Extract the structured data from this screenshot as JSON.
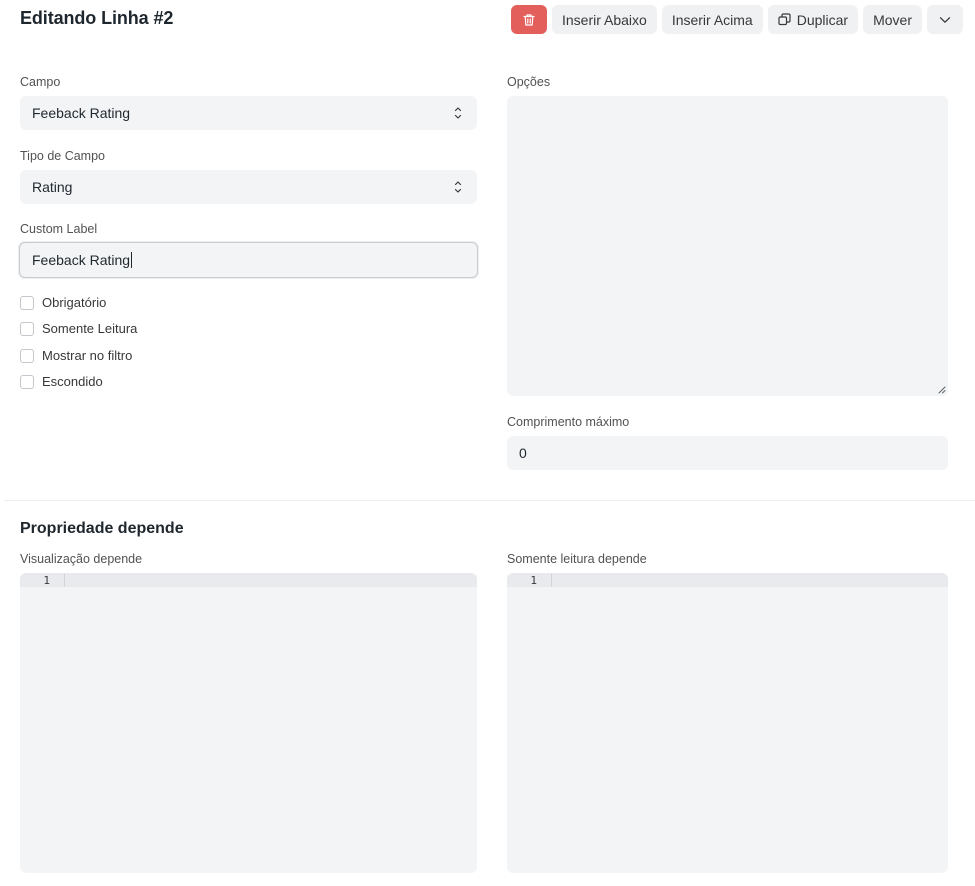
{
  "header": {
    "title": "Editando Linha #2",
    "buttons": {
      "delete_icon": "trash-icon",
      "insert_below": "Inserir Abaixo",
      "insert_above": "Inserir Acima",
      "duplicate": "Duplicar",
      "duplicate_icon": "copy-icon",
      "move": "Mover",
      "more_icon": "chevron-down-icon"
    }
  },
  "form": {
    "campo": {
      "label": "Campo",
      "value": "Feeback Rating"
    },
    "tipo_campo": {
      "label": "Tipo de Campo",
      "value": "Rating"
    },
    "custom_label": {
      "label": "Custom Label",
      "value": "Feeback Rating"
    },
    "checkboxes": [
      {
        "label": "Obrigatório",
        "checked": false
      },
      {
        "label": "Somente Leitura",
        "checked": false
      },
      {
        "label": "Mostrar no filtro",
        "checked": false
      },
      {
        "label": "Escondido",
        "checked": false
      }
    ],
    "opcoes": {
      "label": "Opções",
      "value": ""
    },
    "comprimento_maximo": {
      "label": "Comprimento máximo",
      "value": "0"
    }
  },
  "section": {
    "title": "Propriedade depende",
    "visualizacao": {
      "label": "Visualização depende",
      "line_number": "1"
    },
    "somente_leitura": {
      "label": "Somente leitura depende",
      "line_number": "1"
    }
  },
  "colors": {
    "danger": "#e35f5b",
    "field_bg": "#f3f4f6",
    "button_bg": "#f0f1f3",
    "text": "#1f272e"
  }
}
